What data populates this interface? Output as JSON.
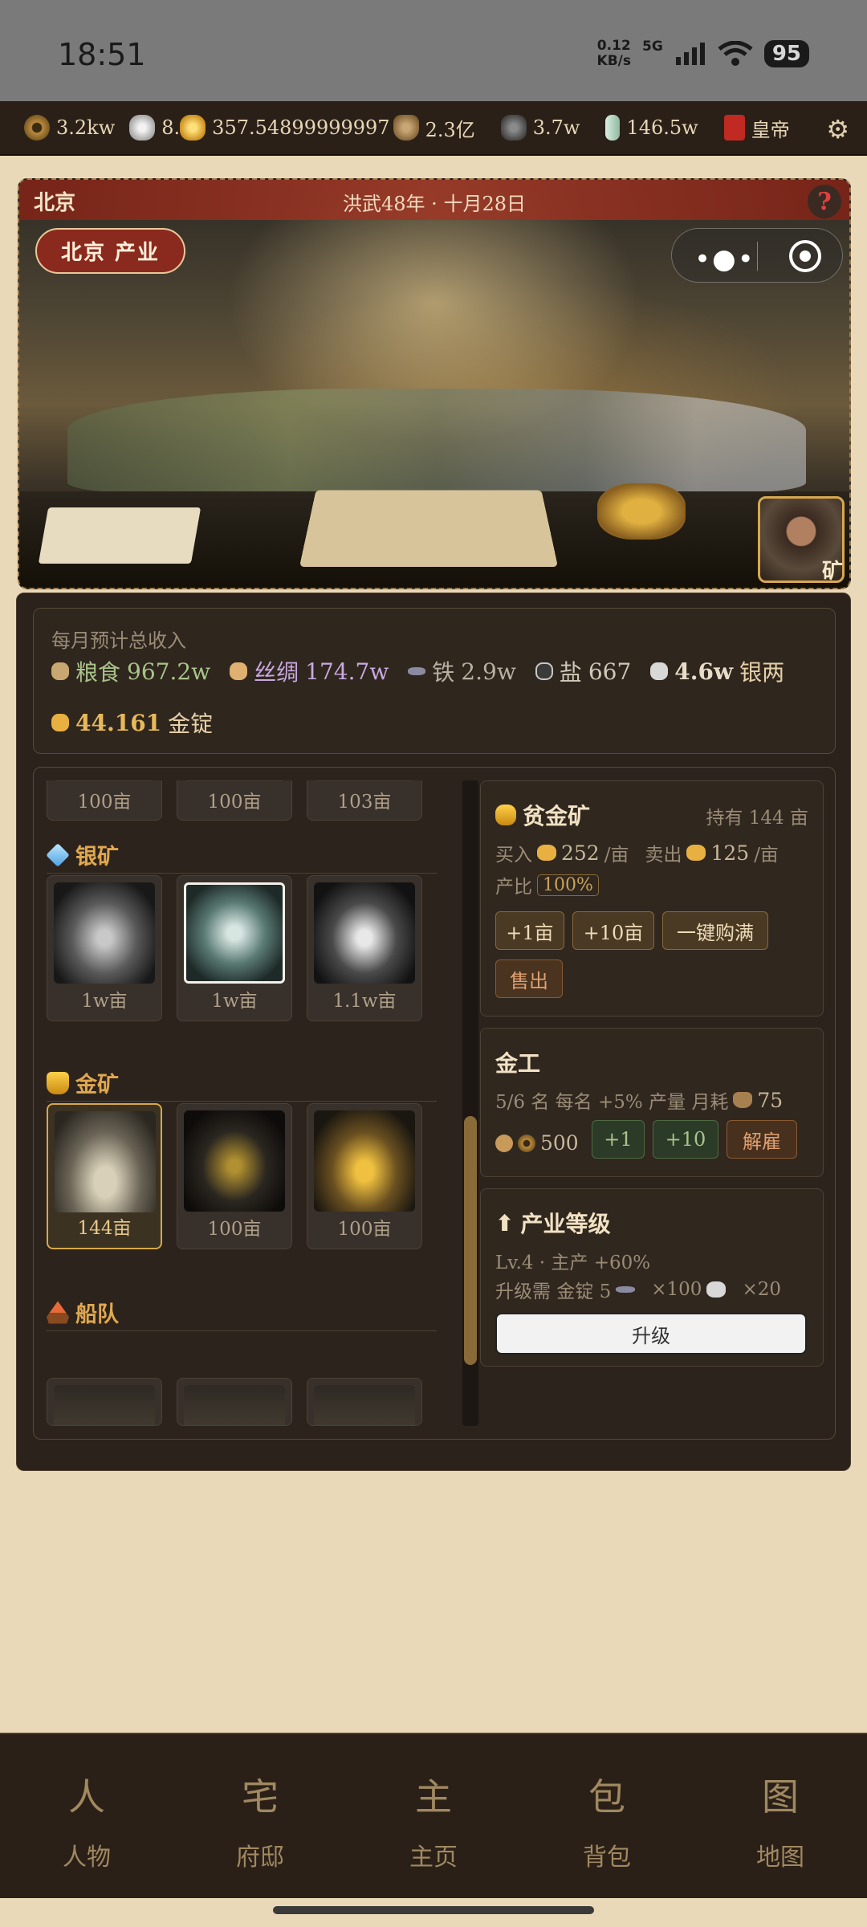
{
  "status": {
    "time": "18:51",
    "speed_val": "0.12",
    "speed_unit": "KB/s",
    "net": "5G",
    "battery": "95"
  },
  "resources": [
    {
      "icon": "copper-coin-icon",
      "value": "3.2kw"
    },
    {
      "icon": "silver-ingot-icon",
      "value": "8."
    },
    {
      "icon": "gold-ingot-icon",
      "value": "357.54899999997"
    },
    {
      "icon": "money-bag-icon",
      "value": "2.3亿"
    },
    {
      "icon": "iron-ore-icon",
      "value": "3.7w"
    },
    {
      "icon": "jade-icon",
      "value": "146.5w"
    },
    {
      "icon": "rank-book-icon",
      "value": "皇帝"
    }
  ],
  "banner": {
    "city": "北京",
    "date": "洪武48年 · 十月28日",
    "industry_tag": "北京 产业",
    "help": "?",
    "portrait_label": "矿"
  },
  "income": {
    "title": "每月预计总收入",
    "items": [
      {
        "name": "粮食",
        "value": "967.2w"
      },
      {
        "name": "丝绸",
        "value": "174.7w"
      },
      {
        "name": "铁",
        "value": "2.9w"
      },
      {
        "name": "盐",
        "value": "667"
      },
      {
        "name": "",
        "value": "4.6w",
        "unit": "银两"
      },
      {
        "name": "",
        "value": "44.161",
        "unit": "金锭"
      }
    ]
  },
  "tiles_top": [
    "100亩",
    "100亩",
    "103亩"
  ],
  "silver_mine": {
    "title": "银矿",
    "tiles": [
      "1w亩",
      "1w亩",
      "1.1w亩"
    ]
  },
  "gold_mine": {
    "title": "金矿",
    "tiles": [
      "144亩",
      "100亩",
      "100亩"
    ]
  },
  "fleet": {
    "title": "船队"
  },
  "detail": {
    "title": "贫金矿",
    "held": "持有 144 亩",
    "buy_label": "买入",
    "buy_value": "252",
    "per": "/亩",
    "sell_label": "卖出",
    "sell_value": "125",
    "ratio_label": "产比",
    "ratio_value": "100%",
    "btn_plus1": "+1亩",
    "btn_plus10": "+10亩",
    "btn_fill": "一键购满",
    "btn_sell": "售出"
  },
  "workers": {
    "title": "金工",
    "info": "5/6 名  每名 +5% 产量  月耗",
    "cost": "75",
    "hire_cost": "500",
    "btn_plus1": "+1",
    "btn_plus10": "+10",
    "btn_fire": "解雇"
  },
  "level": {
    "title": "产业等级",
    "info": "Lv.4 · 主产 +60%",
    "req_label": "升级需 金锭 5",
    "req_iron": "×100",
    "req_silver": "×20",
    "btn": "升级"
  },
  "nav": [
    {
      "glyph": "人",
      "label": "人物"
    },
    {
      "glyph": "宅",
      "label": "府邸"
    },
    {
      "glyph": "主",
      "label": "主页"
    },
    {
      "glyph": "包",
      "label": "背包"
    },
    {
      "glyph": "图",
      "label": "地图"
    }
  ]
}
